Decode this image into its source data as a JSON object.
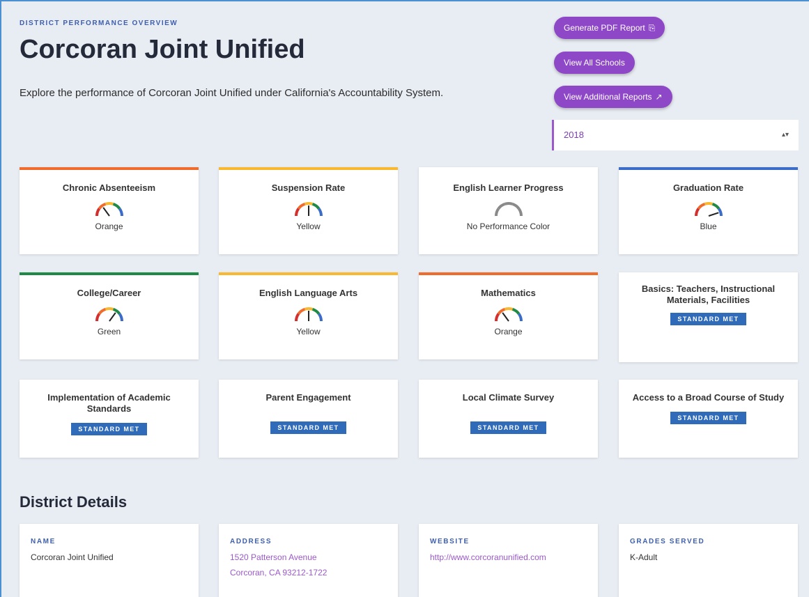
{
  "header": {
    "eyebrow": "DISTRICT PERFORMANCE OVERVIEW",
    "title": "Corcoran Joint Unified",
    "description": "Explore the performance of Corcoran Joint Unified under California's Accountability System."
  },
  "actions": {
    "pdf_label": "Generate PDF Report",
    "schools_label": "View All Schools",
    "additional_label": "View Additional Reports"
  },
  "year_select": {
    "value": "2018"
  },
  "colors": {
    "orange": "#ef6c2c",
    "yellow": "#f8b830",
    "blue": "#3b6cc8",
    "green": "#1f8a45",
    "purple": "#8e47c6",
    "badge": "#2f6bb8"
  },
  "indicators": [
    {
      "title": "Chronic Absenteeism",
      "label": "Orange",
      "level": 2
    },
    {
      "title": "Suspension Rate",
      "label": "Yellow",
      "level": 3
    },
    {
      "title": "English Learner Progress",
      "label": "No Performance Color",
      "level": 0
    },
    {
      "title": "Graduation Rate",
      "label": "Blue",
      "level": 5
    },
    {
      "title": "College/Career",
      "label": "Green",
      "level": 4
    },
    {
      "title": "English Language Arts",
      "label": "Yellow",
      "level": 3
    },
    {
      "title": "Mathematics",
      "label": "Orange",
      "level": 2
    }
  ],
  "standards": [
    {
      "title": "Basics: Teachers, Instructional Materials, Facilities",
      "badge": "STANDARD MET"
    },
    {
      "title": "Implementation of Academic Standards",
      "badge": "STANDARD MET"
    },
    {
      "title": "Parent Engagement",
      "badge": "STANDARD MET"
    },
    {
      "title": "Local Climate Survey",
      "badge": "STANDARD MET"
    },
    {
      "title": "Access to a Broad Course of Study",
      "badge": "STANDARD MET"
    }
  ],
  "details": {
    "section_title": "District Details",
    "name_label": "NAME",
    "name_value": "Corcoran Joint Unified",
    "address_label": "ADDRESS",
    "address_line1": "1520 Patterson Avenue",
    "address_line2": "Corcoran, CA 93212-1722",
    "website_label": "WEBSITE",
    "website_value": "http://www.corcoranunified.com",
    "grades_label": "GRADES SERVED",
    "grades_value": "K-Adult"
  }
}
